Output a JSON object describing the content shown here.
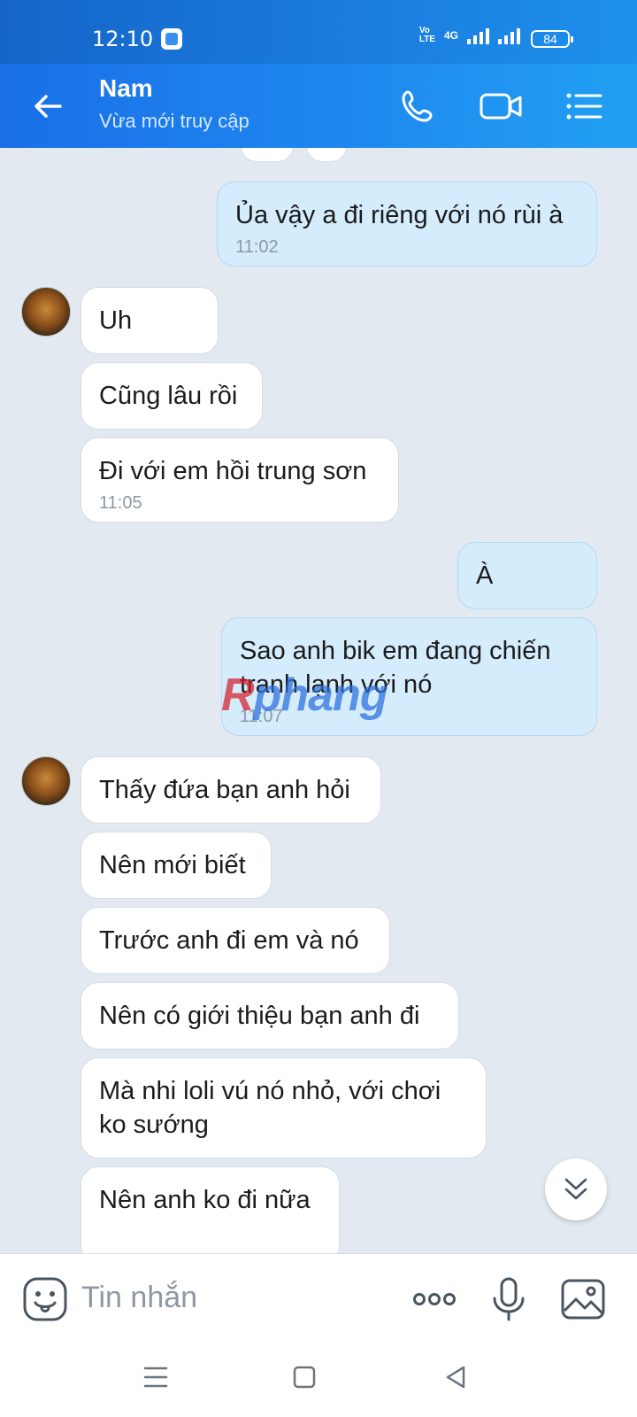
{
  "status": {
    "time": "12:10",
    "network": "4G",
    "battery": "84"
  },
  "header": {
    "title": "Nam",
    "subtitle": "Vừa mới truy cập"
  },
  "messages": [
    {
      "direction": "out",
      "text": "Ủa vậy a đi riêng với nó rùi à",
      "time": "11:02"
    },
    {
      "direction": "in",
      "text": "Uh"
    },
    {
      "direction": "in",
      "text": "Cũng lâu rồi"
    },
    {
      "direction": "in",
      "text": "Đi với em hồi trung sơn",
      "time": "11:05"
    },
    {
      "direction": "out",
      "text": "À"
    },
    {
      "direction": "out",
      "text": "Sao anh bik em đang chiến tranh lạnh với nó",
      "time": "11:07"
    },
    {
      "direction": "in",
      "text": "Thấy đứa bạn anh hỏi"
    },
    {
      "direction": "in",
      "text": "Nên mới biết"
    },
    {
      "direction": "in",
      "text": "Trước anh đi em và nó"
    },
    {
      "direction": "in",
      "text": "Nên có giới thiệu bạn anh đi"
    },
    {
      "direction": "in",
      "text": "Mà nhi loli vú nó nhỏ, với chơi ko sướng"
    },
    {
      "direction": "in",
      "text": "Nên anh ko đi nữa"
    }
  ],
  "watermark": {
    "part1": "R",
    "part2": "phang"
  },
  "composer": {
    "placeholder": "Tin nhắn"
  },
  "colors": {
    "header": "#1f8bf0",
    "outgoing_bubble": "#d5ecfd",
    "incoming_bubble": "#ffffff",
    "background": "#e2e9f1"
  }
}
